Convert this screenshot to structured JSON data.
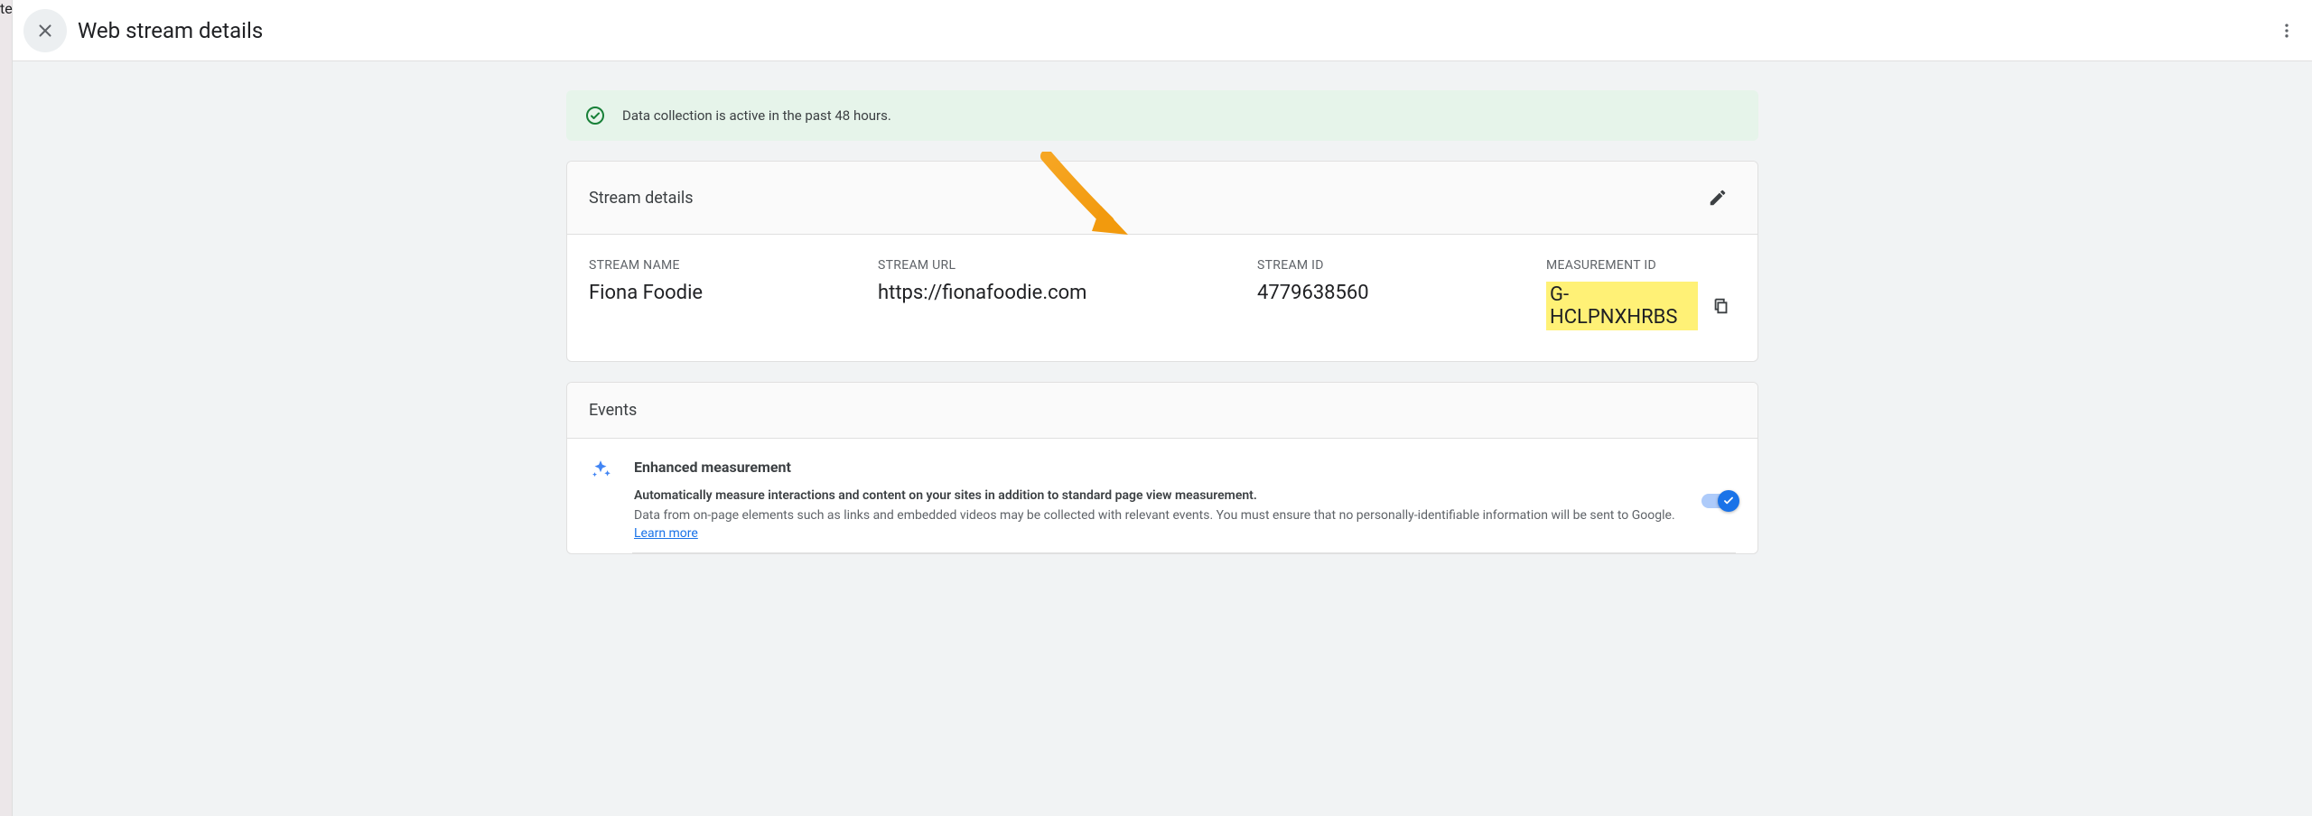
{
  "header": {
    "title": "Web stream details"
  },
  "status": {
    "message": "Data collection is active in the past 48 hours."
  },
  "stream_details": {
    "section_title": "Stream details",
    "name_label": "STREAM NAME",
    "name_value": "Fiona Foodie",
    "url_label": "STREAM URL",
    "url_value": "https://fionafoodie.com",
    "id_label": "STREAM ID",
    "id_value": "4779638560",
    "measurement_label": "MEASUREMENT ID",
    "measurement_value": "G-HCLPNXHRBS"
  },
  "events": {
    "section_title": "Events",
    "enhanced": {
      "title": "Enhanced measurement",
      "line1": "Automatically measure interactions and content on your sites in addition to standard page view measurement.",
      "line2": "Data from on-page elements such as links and embedded videos may be collected with relevant events. You must ensure that no personally-identifiable information will be sent to Google. ",
      "learn_more": "Learn more",
      "toggle_on": true
    }
  }
}
